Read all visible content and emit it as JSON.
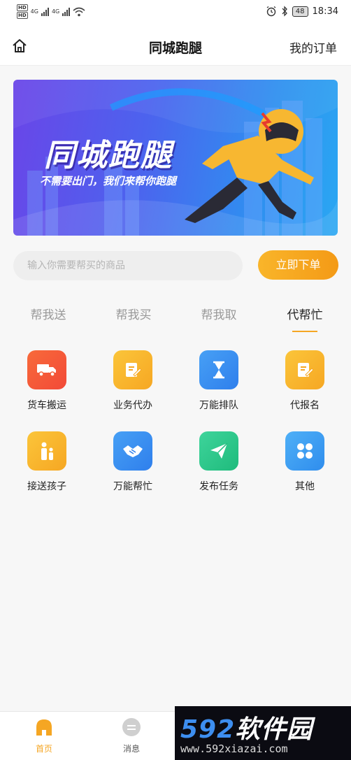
{
  "status_bar": {
    "hd_labels": [
      "HD",
      "HD"
    ],
    "net_labels": [
      "4G",
      "4G"
    ],
    "battery": "48",
    "time": "18:34"
  },
  "nav": {
    "title": "同城跑腿",
    "orders_label": "我的订单"
  },
  "banner": {
    "title": "同城跑腿",
    "subtitle": "不需要出门，我们来帮你跑腿"
  },
  "search": {
    "placeholder": "输入你需要帮买的商品",
    "order_button": "立即下单"
  },
  "tabs": [
    "帮我送",
    "帮我买",
    "帮我取",
    "代帮忙"
  ],
  "active_tab": "代帮忙",
  "services": [
    {
      "label": "货车搬运",
      "icon": "truck-icon",
      "color": "#f4603a"
    },
    {
      "label": "业务代办",
      "icon": "edit-note-icon",
      "color": "#f8b52a"
    },
    {
      "label": "万能排队",
      "icon": "hourglass-icon",
      "color": "#3a8ff0"
    },
    {
      "label": "代报名",
      "icon": "signup-icon",
      "color": "#f8b52a"
    },
    {
      "label": "接送孩子",
      "icon": "parent-child-icon",
      "color": "#f8b52a"
    },
    {
      "label": "万能帮忙",
      "icon": "handshake-icon",
      "color": "#3a8ff0"
    },
    {
      "label": "发布任务",
      "icon": "paper-plane-icon",
      "color": "#2cc98a"
    },
    {
      "label": "其他",
      "icon": "grid-dots-icon",
      "color": "#3a9cf3"
    }
  ],
  "tab_bar": {
    "home_label": "首页",
    "messages_label": "消息"
  },
  "watermark": {
    "brand_num": "592",
    "brand_text": "软件园",
    "url": "www.592xiazai.com"
  },
  "colors": {
    "accent": "#f5a623",
    "banner_start": "#6a45e8",
    "banner_end": "#2aa7f2"
  }
}
